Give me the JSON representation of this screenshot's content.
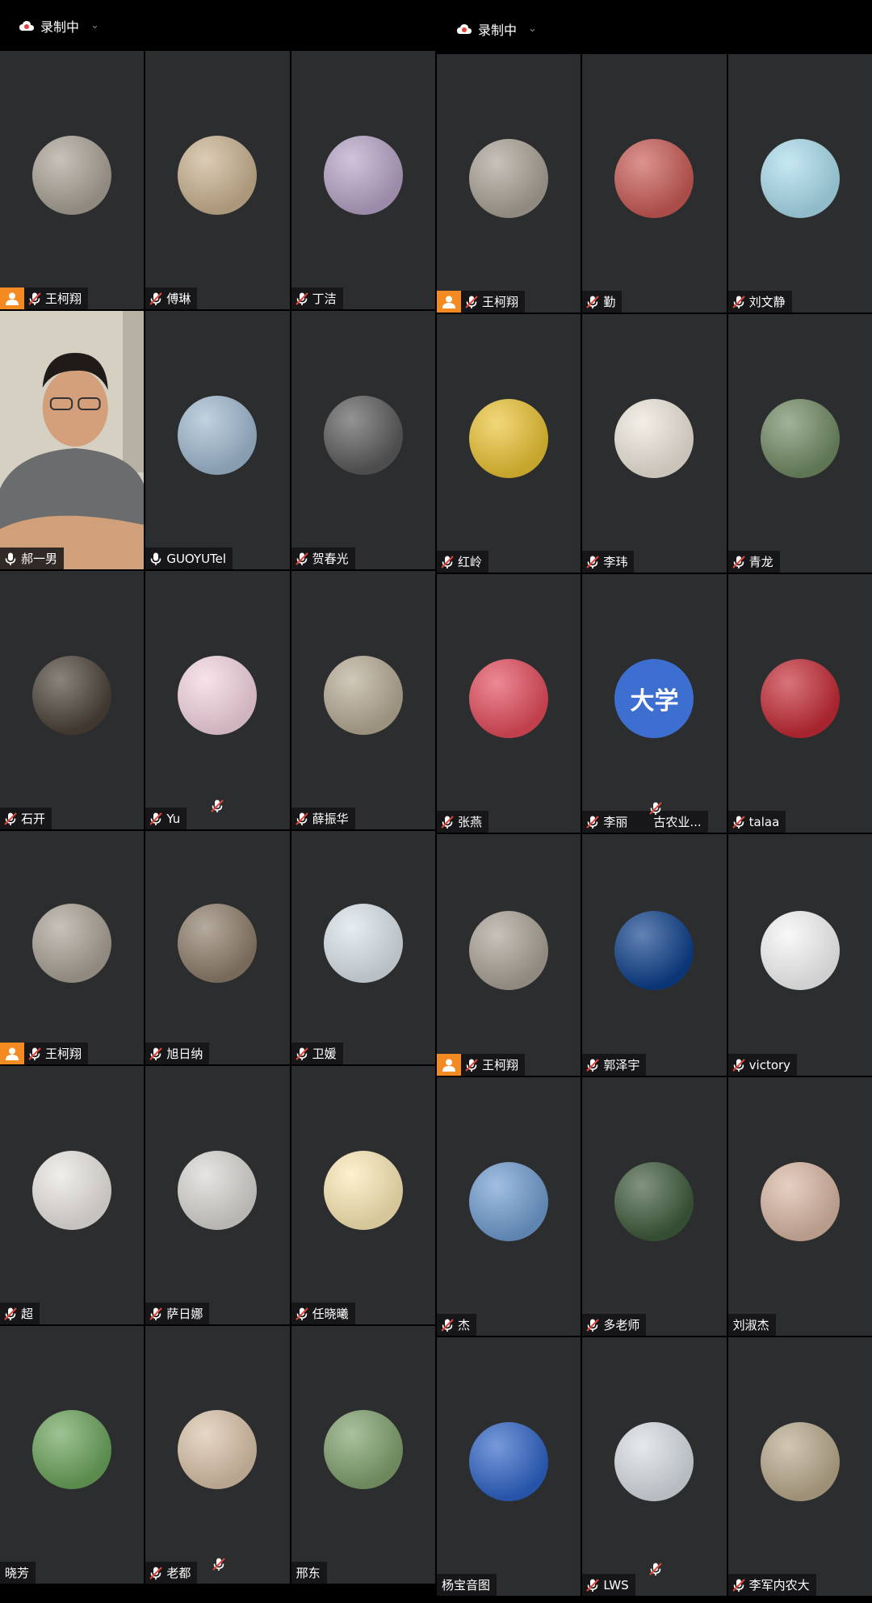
{
  "left_panel": {
    "recording_label": "录制中",
    "tiles": [
      {
        "name": "王柯翔",
        "host": true,
        "mic": "muted",
        "avatar": "dog-hug-avatar",
        "bg": "#a9a195"
      },
      {
        "name": "傅琳",
        "host": false,
        "mic": "muted",
        "avatar": "figurines-avatar",
        "bg": "#c9b18f"
      },
      {
        "name": "丁洁",
        "host": false,
        "mic": "muted",
        "avatar": "plaid-selfie-avatar",
        "bg": "#b6a3c6"
      },
      {
        "name": "郝一男",
        "host": false,
        "mic": "on",
        "avatar": "video-feed",
        "bg": "#cfc7b6",
        "video": true
      },
      {
        "name": "GUOYUTel",
        "host": false,
        "mic": "on",
        "avatar": "lake-person-avatar",
        "bg": "#9fb9cf"
      },
      {
        "name": "贺春光",
        "host": false,
        "mic": "muted",
        "avatar": "hand-bw-avatar",
        "bg": "#5a5a5a"
      },
      {
        "name": "石开",
        "host": false,
        "mic": "muted",
        "avatar": "stone-carving-avatar",
        "bg": "#4b4238"
      },
      {
        "name": "Yu",
        "host": false,
        "mic": "muted",
        "avatar": "cartoon-elephant-avatar",
        "bg": "#f4d4e0"
      },
      {
        "name": "薛振华",
        "host": false,
        "mic": "muted",
        "avatar": "road-person-avatar",
        "bg": "#b6aa94"
      },
      {
        "name": "王柯翔",
        "host": true,
        "mic": "muted",
        "avatar": "dog-hug-avatar",
        "bg": "#a9a195"
      },
      {
        "name": "旭日纳",
        "host": false,
        "mic": "muted",
        "avatar": "woman-portrait-avatar",
        "bg": "#8d7d6a"
      },
      {
        "name": "卫媛",
        "host": false,
        "mic": "muted",
        "avatar": "flowers-avatar",
        "bg": "#d9e3ea"
      },
      {
        "name": "超",
        "host": false,
        "mic": "muted",
        "avatar": "family-avatar",
        "bg": "#e8e4e0"
      },
      {
        "name": "萨日娜",
        "host": false,
        "mic": "muted",
        "avatar": "white-cat-avatar",
        "bg": "#d8d6d2"
      },
      {
        "name": "任晓曦",
        "host": false,
        "mic": "muted",
        "avatar": "sun-smile-avatar",
        "bg": "#fbe9b4"
      },
      {
        "name": "晓芳",
        "host": false,
        "mic": "none",
        "avatar": "lotus-avatar",
        "bg": "#6aa35a"
      },
      {
        "name": "老都",
        "host": false,
        "mic": "muted",
        "avatar": "child-avatar",
        "bg": "#d9c2a8"
      },
      {
        "name": "邢东",
        "host": false,
        "mic": "none",
        "avatar": "tree-avatar",
        "bg": "#7fa06c"
      }
    ]
  },
  "right_panel": {
    "recording_label": "录制中",
    "tiles": [
      {
        "name": "王柯翔",
        "host": true,
        "mic": "muted",
        "avatar": "dog-hug-avatar",
        "bg": "#a9a195"
      },
      {
        "name": "勤",
        "host": false,
        "mic": "muted",
        "avatar": "umbrellas-avatar",
        "bg": "#c85a54"
      },
      {
        "name": "刘文静",
        "host": false,
        "mic": "muted",
        "avatar": "lone-tree-avatar",
        "bg": "#a9dcec"
      },
      {
        "name": "红岭",
        "host": false,
        "mic": "muted",
        "avatar": "test-pattern-avatar",
        "bg": "#e9c233"
      },
      {
        "name": "李玮",
        "host": false,
        "mic": "muted",
        "avatar": "dancer-avatar",
        "bg": "#ece5da"
      },
      {
        "name": "青龙",
        "host": false,
        "mic": "muted",
        "avatar": "landscape-grid-avatar",
        "bg": "#6f8a62"
      },
      {
        "name": "张燕",
        "host": false,
        "mic": "muted",
        "avatar": "panda-girl-avatar",
        "bg": "#e24b5b"
      },
      {
        "name": "李丽",
        "host": false,
        "mic": "muted",
        "avatar": "text-avatar",
        "bg": "#3d6fd1",
        "avatar_text": "大学",
        "name_suffix": "古农业..."
      },
      {
        "name": "talaa",
        "host": false,
        "mic": "muted",
        "avatar": "deer-logo-avatar",
        "bg": "#c32a35"
      },
      {
        "name": "王柯翔",
        "host": true,
        "mic": "muted",
        "avatar": "dog-hug-avatar",
        "bg": "#a9a195"
      },
      {
        "name": "郭泽宇",
        "host": false,
        "mic": "muted",
        "avatar": "ferris-wheel-avatar",
        "bg": "#0d3f8a"
      },
      {
        "name": "victory",
        "host": false,
        "mic": "muted",
        "avatar": "sketch-girl-avatar",
        "bg": "#f5f5f5"
      },
      {
        "name": "杰",
        "host": false,
        "mic": "muted",
        "avatar": "city-sky-avatar",
        "bg": "#6f9ccf"
      },
      {
        "name": "多老师",
        "host": false,
        "mic": "muted",
        "avatar": "garden-avatar",
        "bg": "#3e5a3b"
      },
      {
        "name": "刘淑杰",
        "host": false,
        "mic": "none",
        "avatar": "kids-play-avatar",
        "bg": "#d8b6a2"
      },
      {
        "name": "杨宝音图",
        "host": false,
        "mic": "none",
        "avatar": "cartoon-boy-avatar",
        "bg": "#2e63c6"
      },
      {
        "name": "LWS",
        "host": false,
        "mic": "muted",
        "avatar": "plant-pot-avatar",
        "bg": "#d7dde3"
      },
      {
        "name": "李军内农大",
        "host": false,
        "mic": "muted",
        "avatar": "man-portrait-avatar",
        "bg": "#b8a98b"
      }
    ]
  },
  "colors": {
    "tile": "#2c2d2f",
    "host_badge": "#f48a22",
    "active_border": "#3fd26e",
    "muted_red": "#e2453c"
  }
}
